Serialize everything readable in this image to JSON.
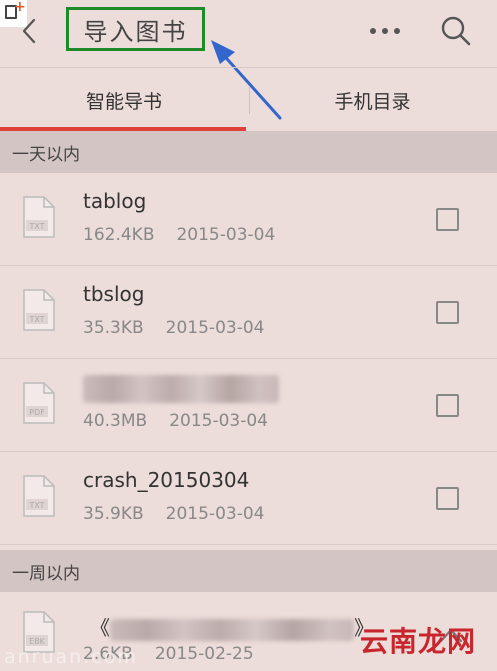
{
  "header": {
    "title": "导入图书",
    "back_icon": "chevron-left-icon",
    "more_icon": "more-dots-icon",
    "search_icon": "search-icon"
  },
  "tabs": [
    {
      "label": "智能导书",
      "active": true
    },
    {
      "label": "手机目录",
      "active": false
    }
  ],
  "sections": [
    {
      "label": "一天以内",
      "items": [
        {
          "type": "TXT",
          "name": "tablog",
          "size": "162.4KB",
          "date": "2015-03-04",
          "checked": false
        },
        {
          "type": "TXT",
          "name": "tbslog",
          "size": "35.3KB",
          "date": "2015-03-04",
          "checked": false
        },
        {
          "type": "PDF",
          "name": "",
          "size": "40.3MB",
          "date": "2015-03-04",
          "checked": false
        },
        {
          "type": "TXT",
          "name": "crash_20150304",
          "size": "35.9KB",
          "date": "2015-03-04",
          "checked": false
        }
      ]
    },
    {
      "label": "一周以内",
      "items": [
        {
          "type": "EBK",
          "name": "《",
          "name_end": "》",
          "size": "2.6KB",
          "date": "2015-02-25"
        }
      ]
    }
  ],
  "watermark": {
    "text": "云南龙网",
    "subtext": "anruan.com"
  },
  "colors": {
    "background": "#ecdcda",
    "accent": "#e0403a",
    "title_highlight": "#1e8a28",
    "annotation_arrow": "#3366cc"
  }
}
